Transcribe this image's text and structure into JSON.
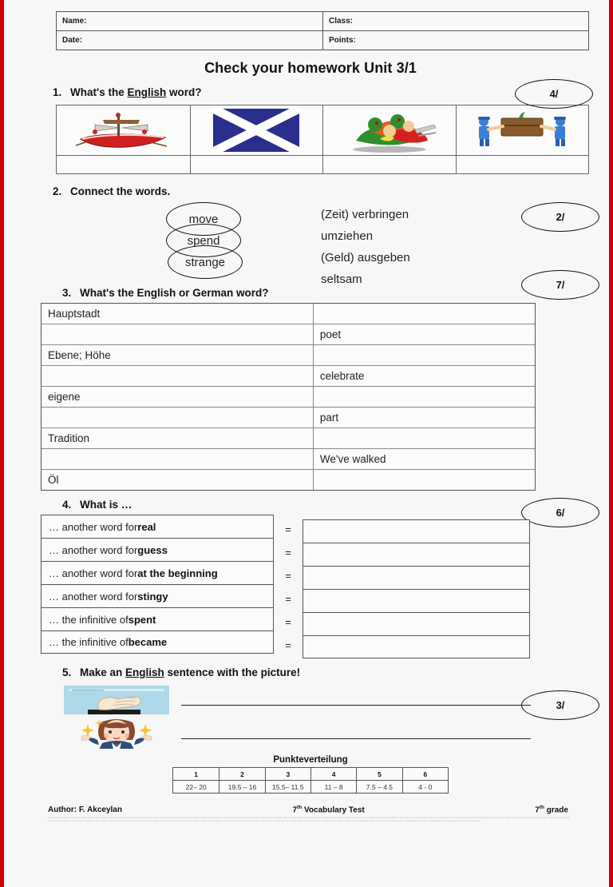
{
  "header": {
    "name_label": "Name:",
    "class_label": "Class:",
    "date_label": "Date:",
    "points_label": "Points:"
  },
  "title": "Check your homework Unit 3/1",
  "questions": [
    {
      "num": "1.",
      "text_before": "What's the ",
      "underlined": "English",
      "text_after": " word?",
      "points": "4/",
      "pictures": [
        "red-boat-picture",
        "scottish-flag-picture",
        "crowd-of-people-picture",
        "people-carrying-furniture-picture"
      ]
    },
    {
      "num": "2.",
      "text": "Connect the words.",
      "points_top": "2/",
      "points_bottom": "7/",
      "english": [
        "move",
        "spend",
        "strange"
      ],
      "german": [
        "(Zeit) verbringen",
        "umziehen",
        "(Geld) ausgeben",
        "seltsam"
      ]
    },
    {
      "num": "3.",
      "text": "What's the English or German word?",
      "rows": [
        {
          "left": "Hauptstadt",
          "right": ""
        },
        {
          "left": "",
          "right": "poet"
        },
        {
          "left": "Ebene; Höhe",
          "right": ""
        },
        {
          "left": "",
          "right": "celebrate"
        },
        {
          "left": "eigene",
          "right": ""
        },
        {
          "left": "",
          "right": "part"
        },
        {
          "left": "Tradition",
          "right": ""
        },
        {
          "left": "",
          "right": "We've walked"
        },
        {
          "left": "Öl",
          "right": ""
        }
      ]
    },
    {
      "num": "4.",
      "text": "What is …",
      "points": "6/",
      "equals": "=",
      "items": [
        {
          "prefix": "… another word for ",
          "word": "real"
        },
        {
          "prefix": "… another word for ",
          "word": "guess"
        },
        {
          "prefix": "… another word for ",
          "word": "at the beginning"
        },
        {
          "prefix": "… another word for ",
          "word": "stingy"
        },
        {
          "prefix": "… the infinitive of ",
          "word": "spent"
        },
        {
          "prefix": "… the infinitive of ",
          "word": "became"
        }
      ]
    },
    {
      "num": "5.",
      "text_before": "Make an ",
      "underlined": "English",
      "text_after": " sentence with the picture!",
      "points": "3/",
      "pictures": [
        "hand-gesture-picture",
        "shrugging-woman-picture"
      ]
    }
  ],
  "grade_table": {
    "title": "Punkteverteilung",
    "grades": [
      "1",
      "2",
      "3",
      "4",
      "5",
      "6"
    ],
    "ranges": [
      "22– 20",
      "19.5 – 16",
      "15.5– 11.5",
      "11 – 8",
      "7.5 – 4.5",
      "4 - 0"
    ]
  },
  "footer": {
    "author": "Author: F. Akceylan",
    "center_prefix": "7",
    "center_sup": "th",
    "center_suffix": " Vocabulary Test",
    "right_prefix": "7",
    "right_sup": "th",
    "right_suffix": " grade"
  },
  "colors": {
    "page_border": "#cc0000",
    "flag_blue": "#2b2e8c",
    "boat_red": "#d01f1f",
    "crowd_green": "#2f8f2f",
    "furniture_brown": "#8a5a2b",
    "worker_blue": "#3a7fd5",
    "q5_sky": "#add9e8",
    "woman_hair": "#8b4a2f",
    "woman_suit": "#2e4d78"
  }
}
